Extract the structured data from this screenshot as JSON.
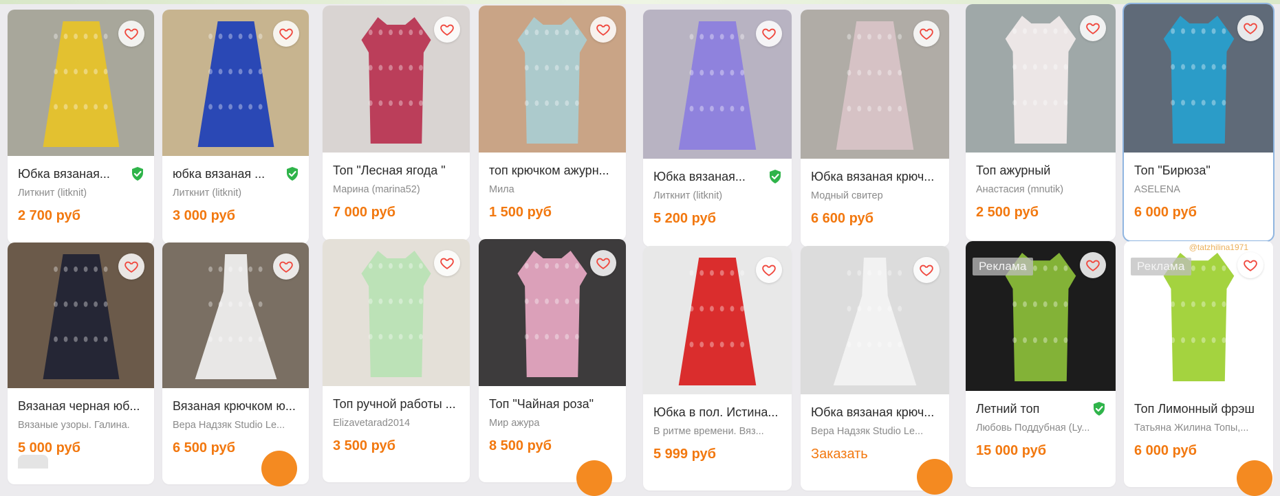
{
  "colors": {
    "price": "#f2780f",
    "verified": "#2fb44a",
    "heart": "#f0483e",
    "background": "#ecebee"
  },
  "products": [
    {
      "title": "Юбка вязаная...",
      "seller": "Литкнит (litknit)",
      "price": "2 700 руб",
      "verified": true,
      "ad": false,
      "selected": false,
      "garment": "skirt",
      "garment_color": "#e8c327",
      "bg_color": "#a8a79b",
      "icon": "heart-icon"
    },
    {
      "title": "юбка вязаная ...",
      "seller": "Литкнит (litknit)",
      "price": "3 000 руб",
      "verified": true,
      "ad": false,
      "selected": false,
      "garment": "skirt",
      "garment_color": "#1c3fb8",
      "bg_color": "#c7b48f",
      "icon": "heart-icon"
    },
    {
      "title": "Топ \"Лесная ягода \"",
      "seller": "Марина (marina52)",
      "price": "7 000 руб",
      "verified": false,
      "ad": false,
      "selected": false,
      "garment": "top",
      "garment_color": "#b8314f",
      "bg_color": "#d9d4d2",
      "icon": "heart-icon"
    },
    {
      "title": "топ крючком ажурн...",
      "seller": "Мила",
      "price": "1 500 руб",
      "verified": false,
      "ad": false,
      "selected": false,
      "garment": "top",
      "garment_color": "#a9cdd3",
      "bg_color": "#c9a486",
      "icon": "heart-icon"
    },
    {
      "title": "Юбка вязаная...",
      "seller": "Литкнит (litknit)",
      "price": "5 200 руб",
      "verified": true,
      "ad": false,
      "selected": false,
      "garment": "skirt",
      "garment_color": "#8b7ee0",
      "bg_color": "#b8b3c2",
      "icon": "heart-icon"
    },
    {
      "title": "Юбка вязаная крюч...",
      "seller": "Модный свитер",
      "price": "6 600 руб",
      "verified": false,
      "ad": false,
      "selected": false,
      "garment": "skirt",
      "garment_color": "#d9c3c8",
      "bg_color": "#b0aca6",
      "icon": "heart-icon"
    },
    {
      "title": "Топ ажурный",
      "seller": "Анастасия (mnutik)",
      "price": "2 500 руб",
      "verified": false,
      "ad": false,
      "selected": false,
      "garment": "top",
      "garment_color": "#f2eceb",
      "bg_color": "#9fa8a8",
      "icon": "heart-icon"
    },
    {
      "title": "Топ \"Бирюза\"",
      "seller": "ASELENA",
      "price": "6 000 руб",
      "verified": false,
      "ad": false,
      "selected": true,
      "garment": "top",
      "garment_color": "#27a1cf",
      "bg_color": "#5f6a78",
      "icon": "heart-icon"
    },
    {
      "title": "Вязаная черная юб...",
      "seller": "Вязаные узоры. Галина.",
      "price": "5 000 руб",
      "verified": false,
      "ad": false,
      "selected": false,
      "garment": "skirt",
      "garment_color": "#1f2233",
      "bg_color": "#6b5a4a",
      "icon": "heart-icon"
    },
    {
      "title": "Вязаная крючком ю...",
      "seller": "Вера Надзяк Studio Le...",
      "price": "6 500 руб",
      "verified": false,
      "ad": false,
      "selected": false,
      "garment": "dress",
      "garment_color": "#f1f1f1",
      "bg_color": "#7a6f63",
      "icon": "heart-icon"
    },
    {
      "title": "Топ ручной работы ...",
      "seller": "Elizavetarad2014",
      "price": "3 500 руб",
      "verified": false,
      "ad": false,
      "selected": false,
      "garment": "top",
      "garment_color": "#b9e2b4",
      "bg_color": "#e4e0d8",
      "icon": "heart-icon"
    },
    {
      "title": "Топ \"Чайная роза\"",
      "seller": "Мир ажура",
      "price": "8 500 руб",
      "verified": false,
      "ad": false,
      "selected": false,
      "garment": "top",
      "garment_color": "#e8a9c4",
      "bg_color": "#3d3b3c",
      "icon": "heart-icon"
    },
    {
      "title": "Юбка в пол. Истина...",
      "seller": "В ритме времени. Вяз...",
      "price": "5 999 руб",
      "verified": false,
      "ad": false,
      "selected": false,
      "garment": "skirt",
      "garment_color": "#d81c1c",
      "bg_color": "#e8e8e8",
      "icon": "heart-icon"
    },
    {
      "title": "Юбка вязаная крюч...",
      "seller": "Вера Надзяк Studio Le...",
      "price": "Заказать",
      "verified": false,
      "ad": false,
      "selected": false,
      "garment": "dress",
      "garment_color": "#f3f3f3",
      "bg_color": "#dcdcdc",
      "icon": "heart-icon"
    },
    {
      "title": "Летний топ",
      "seller": "Любовь Поддубная (Ly...",
      "price": "15 000 руб",
      "verified": true,
      "ad": true,
      "selected": false,
      "garment": "top",
      "garment_color": "#8cbf3a",
      "bg_color": "#1c1c1c",
      "icon": "heart-icon"
    },
    {
      "title": "Топ Лимонный фрэш",
      "seller": "Татьяна Жилина Топы,...",
      "price": "6 000 руб",
      "verified": false,
      "ad": true,
      "selected": false,
      "garment": "top",
      "garment_color": "#9ccf2f",
      "bg_color": "#ffffff",
      "icon": "heart-icon",
      "watermark": "@tatzhilina1971"
    }
  ],
  "ad_label": "Реклама"
}
